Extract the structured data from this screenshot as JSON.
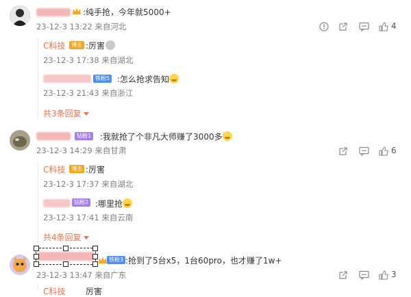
{
  "comments": [
    {
      "text": ":纯手抢，今年就5000+",
      "meta": "23-12-3 13:22 来自河北",
      "likes": "4",
      "replies": [
        {
          "name": "C科技",
          "badge": "博主",
          "text": ":厉害",
          "meta": "23-12-3 17:38 来自湖北"
        },
        {
          "badge": "铁粉5",
          "text": ":怎么抢求告知",
          "meta": "23-12-3 21:43 来自浙江"
        }
      ],
      "more": "共3条回复"
    },
    {
      "badge": "钻粉1",
      "text": ":我就抢了个非凡大师赚了3000多",
      "meta": "23-12-3 14:29 来自甘肃",
      "likes": "6",
      "replies": [
        {
          "name": "C科技",
          "badge": "博主",
          "text": ":厉害",
          "meta": "23-12-3 17:37 来自湖北"
        },
        {
          "badge": "钻粉2",
          "text": ":哪里抢",
          "meta": "23-12-3 17:41 来自云南"
        }
      ],
      "more": "共4条回复"
    },
    {
      "badge": "铁粉3",
      "text": ":抢到了5台x5，1台60pro，也才赚了1w+",
      "meta": "23-12-3 13:47 来自广东",
      "likes": "3",
      "partial_reply": {
        "name": "C科技",
        "text": "厉害"
      }
    }
  ],
  "icons": {
    "report": "info-circle-icon",
    "share": "share-icon",
    "reply": "comment-icon",
    "like": "thumbs-up-icon",
    "more": "caret-down-icon"
  },
  "colors": {
    "accent": "#eb7350",
    "meta": "#808080",
    "badge_blog": "#f5a623",
    "badge_iron": "#4d8ef0",
    "badge_diamond": "#a77ef5"
  }
}
